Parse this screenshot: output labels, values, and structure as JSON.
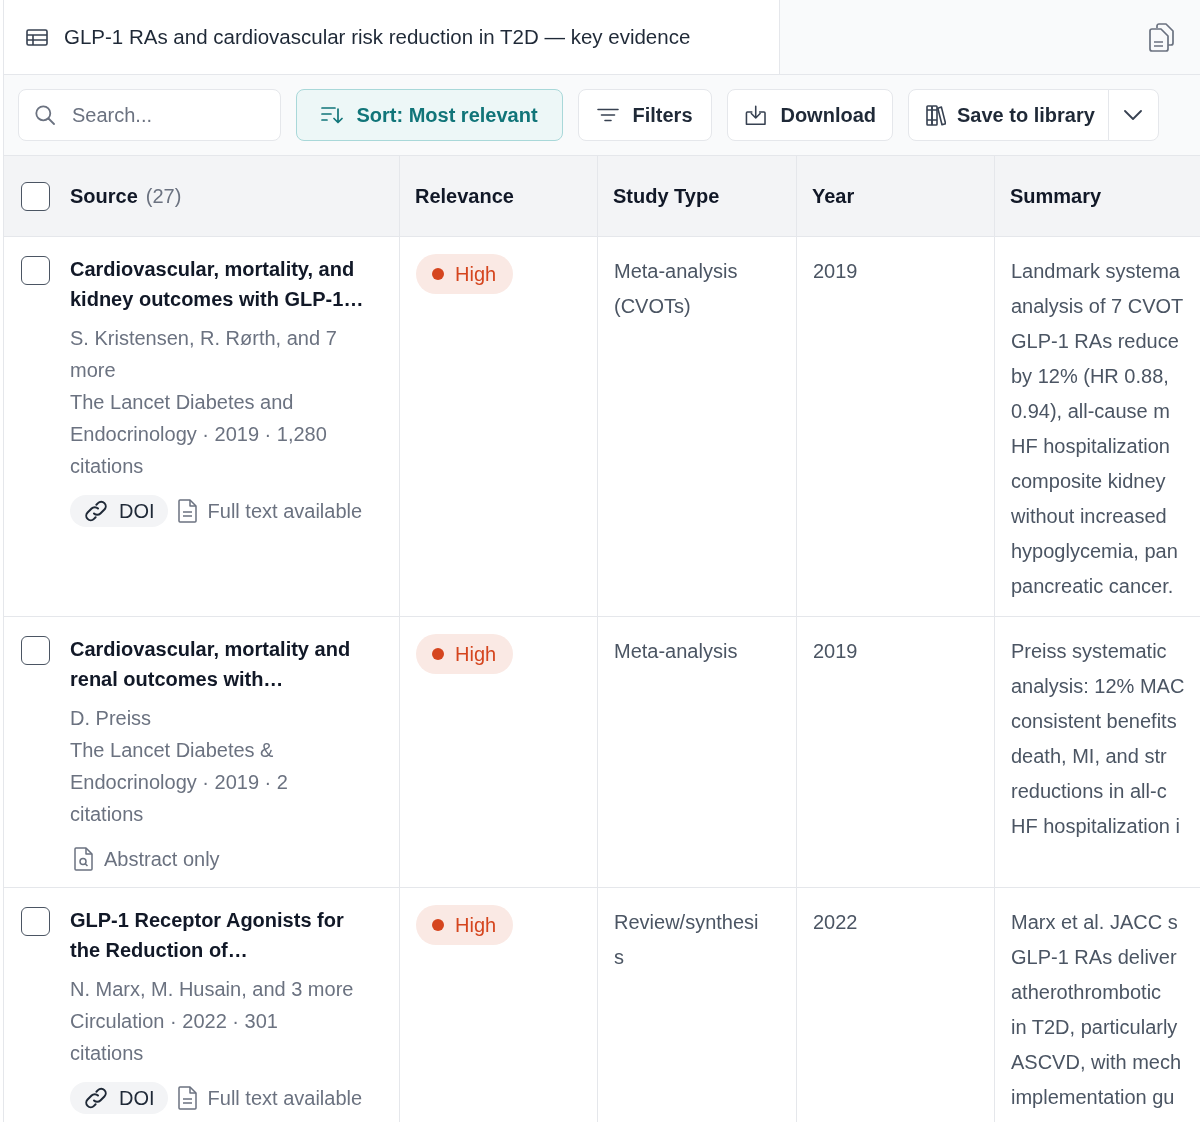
{
  "tab": {
    "title": "GLP-1 RAs and cardiovascular risk reduction in T2D — key evidence"
  },
  "toolbar": {
    "search": {
      "placeholder": "Search..."
    },
    "sort": {
      "label": "Sort: Most relevant",
      "active": true
    },
    "buttons": [
      {
        "kind": "filter",
        "label": "Filters"
      },
      {
        "kind": "download",
        "label": "Download"
      }
    ],
    "save": {
      "label": "Save to library"
    }
  },
  "table": {
    "select_all": {
      "checked": false
    },
    "columns": [
      {
        "label": "Source",
        "count": "(27)"
      },
      {
        "label": "Relevance"
      },
      {
        "label": "Study Type"
      },
      {
        "label": "Year"
      },
      {
        "label": "Summary"
      }
    ],
    "rows": [
      {
        "checked": false,
        "title": "Cardiovascular, mortality, and kidney outcomes with GLP-1…",
        "authors": "S. Kristensen, R. Rørth, and 7 more",
        "journal": "The Lancet Diabetes and Endocrinology · 2019 · 1,280 citations",
        "links": [
          {
            "kind": "doi",
            "label": "DOI"
          },
          {
            "kind": "full_text",
            "label": "Full text available"
          }
        ],
        "relevance": {
          "label": "High",
          "color": "#d5451e"
        },
        "study_type": "Meta-analysis (CVOTs)",
        "year": "2019",
        "summary": [
          "Landmark systema",
          "analysis of 7 CVOT",
          "GLP-1 RAs reduce",
          "by 12% (HR 0.88,",
          "0.94), all-cause m",
          "HF hospitalization",
          "composite kidney",
          "without increased",
          "hypoglycemia, pan",
          "pancreatic cancer."
        ]
      },
      {
        "checked": false,
        "title": "Cardiovascular, mortality and renal outcomes with…",
        "authors": "D. Preiss",
        "journal": "The Lancet Diabetes & Endocrinology · 2019 · 2 citations",
        "links": [
          {
            "kind": "abstract",
            "label": "Abstract only"
          }
        ],
        "relevance": {
          "label": "High",
          "color": "#d5451e"
        },
        "study_type": "Meta-analysis",
        "year": "2019",
        "summary": [
          "Preiss systematic",
          "analysis: 12% MAC",
          "consistent benefits",
          "death, MI, and str",
          "reductions in all-c",
          "HF hospitalization i"
        ]
      },
      {
        "checked": false,
        "title": "GLP-1 Receptor Agonists for the Reduction of…",
        "authors": "N. Marx, M. Husain, and 3 more",
        "journal": "Circulation · 2022 · 301 citations",
        "links": [
          {
            "kind": "doi",
            "label": "DOI"
          },
          {
            "kind": "full_text",
            "label": "Full text available"
          }
        ],
        "relevance": {
          "label": "High",
          "color": "#d5451e"
        },
        "study_type": "Review/synthesis",
        "year": "2022",
        "summary": [
          "Marx et al. JACC s",
          "GLP-1 RAs deliver",
          "atherothrombotic",
          "in T2D, particularly",
          "ASCVD, with mech",
          "implementation gu"
        ]
      }
    ]
  }
}
